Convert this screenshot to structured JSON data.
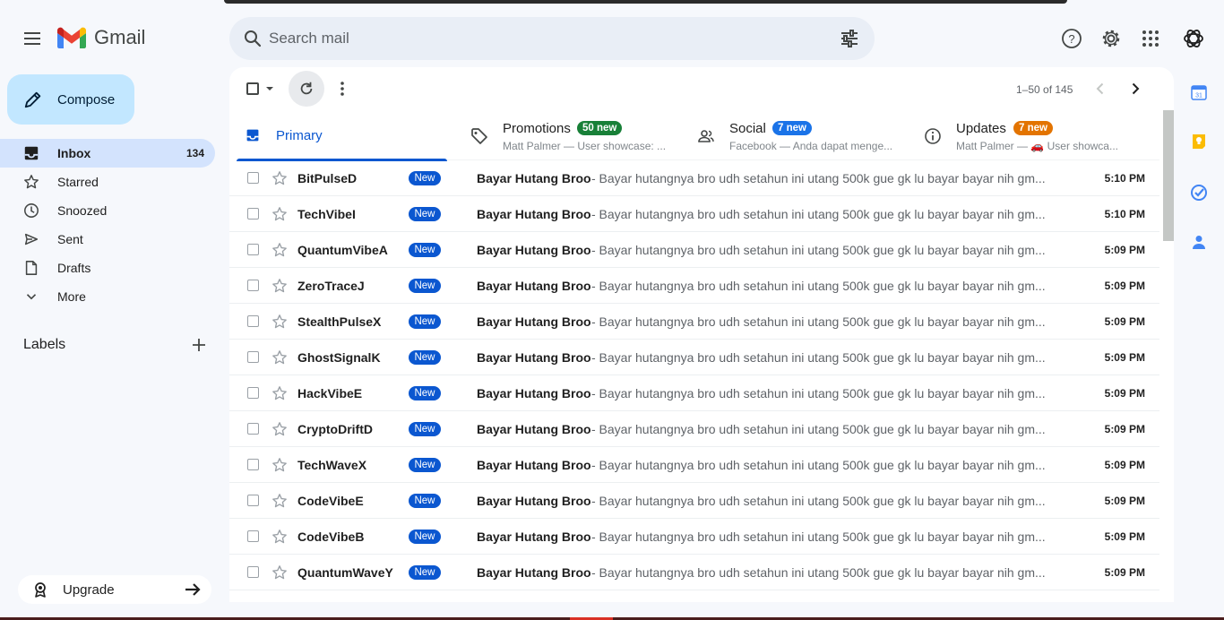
{
  "app": {
    "name": "Gmail"
  },
  "search": {
    "placeholder": "Search mail"
  },
  "compose": {
    "label": "Compose"
  },
  "nav": {
    "items": [
      {
        "label": "Inbox",
        "count": "134",
        "icon": "inbox-icon",
        "active": true
      },
      {
        "label": "Starred",
        "count": "",
        "icon": "star-icon"
      },
      {
        "label": "Snoozed",
        "count": "",
        "icon": "clock-icon"
      },
      {
        "label": "Sent",
        "count": "",
        "icon": "send-icon"
      },
      {
        "label": "Drafts",
        "count": "",
        "icon": "draft-icon"
      },
      {
        "label": "More",
        "count": "",
        "icon": "chevron-down-icon"
      }
    ]
  },
  "labels": {
    "title": "Labels"
  },
  "upgrade": {
    "label": "Upgrade"
  },
  "pagination": {
    "range": "1–50 of 145"
  },
  "tabs": {
    "primary": {
      "label": "Primary"
    },
    "promotions": {
      "label": "Promotions",
      "badge": "50 new",
      "subtitle": "Matt Palmer — User showcase: ..."
    },
    "social": {
      "label": "Social",
      "badge": "7 new",
      "subtitle": "Facebook — Anda dapat menge..."
    },
    "updates": {
      "label": "Updates",
      "badge": "7 new",
      "subtitle": "Matt Palmer — 🚗 User showca..."
    }
  },
  "colors": {
    "accent": "#0b57d0",
    "compose_bg": "#c2e7ff",
    "promotions_badge": "#188038",
    "social_badge": "#1a73e8",
    "updates_badge": "#e37400"
  },
  "emails": [
    {
      "sender": "BitPulseD",
      "badge": "New",
      "subject": "Bayar Hutang Broo",
      "snippet": " - Bayar hutangnya bro udh setahun ini utang 500k gue gk lu bayar bayar nih gm...",
      "time": "5:10 PM"
    },
    {
      "sender": "TechVibeI",
      "badge": "New",
      "subject": "Bayar Hutang Broo",
      "snippet": " - Bayar hutangnya bro udh setahun ini utang 500k gue gk lu bayar bayar nih gm...",
      "time": "5:10 PM"
    },
    {
      "sender": "QuantumVibeA",
      "badge": "New",
      "subject": "Bayar Hutang Broo",
      "snippet": " - Bayar hutangnya bro udh setahun ini utang 500k gue gk lu bayar bayar nih gm...",
      "time": "5:09 PM"
    },
    {
      "sender": "ZeroTraceJ",
      "badge": "New",
      "subject": "Bayar Hutang Broo",
      "snippet": " - Bayar hutangnya bro udh setahun ini utang 500k gue gk lu bayar bayar nih gm...",
      "time": "5:09 PM"
    },
    {
      "sender": "StealthPulseX",
      "badge": "New",
      "subject": "Bayar Hutang Broo",
      "snippet": " - Bayar hutangnya bro udh setahun ini utang 500k gue gk lu bayar bayar nih gm...",
      "time": "5:09 PM"
    },
    {
      "sender": "GhostSignalK",
      "badge": "New",
      "subject": "Bayar Hutang Broo",
      "snippet": " - Bayar hutangnya bro udh setahun ini utang 500k gue gk lu bayar bayar nih gm...",
      "time": "5:09 PM"
    },
    {
      "sender": "HackVibeE",
      "badge": "New",
      "subject": "Bayar Hutang Broo",
      "snippet": " - Bayar hutangnya bro udh setahun ini utang 500k gue gk lu bayar bayar nih gm...",
      "time": "5:09 PM"
    },
    {
      "sender": "CryptoDriftD",
      "badge": "New",
      "subject": "Bayar Hutang Broo",
      "snippet": " - Bayar hutangnya bro udh setahun ini utang 500k gue gk lu bayar bayar nih gm...",
      "time": "5:09 PM"
    },
    {
      "sender": "TechWaveX",
      "badge": "New",
      "subject": "Bayar Hutang Broo",
      "snippet": " - Bayar hutangnya bro udh setahun ini utang 500k gue gk lu bayar bayar nih gm...",
      "time": "5:09 PM"
    },
    {
      "sender": "CodeVibeE",
      "badge": "New",
      "subject": "Bayar Hutang Broo",
      "snippet": " - Bayar hutangnya bro udh setahun ini utang 500k gue gk lu bayar bayar nih gm...",
      "time": "5:09 PM"
    },
    {
      "sender": "CodeVibeB",
      "badge": "New",
      "subject": "Bayar Hutang Broo",
      "snippet": " - Bayar hutangnya bro udh setahun ini utang 500k gue gk lu bayar bayar nih gm...",
      "time": "5:09 PM"
    },
    {
      "sender": "QuantumWaveY",
      "badge": "New",
      "subject": "Bayar Hutang Broo",
      "snippet": " - Bayar hutangnya bro udh setahun ini utang 500k gue gk lu bayar bayar nih gm...",
      "time": "5:09 PM"
    }
  ]
}
